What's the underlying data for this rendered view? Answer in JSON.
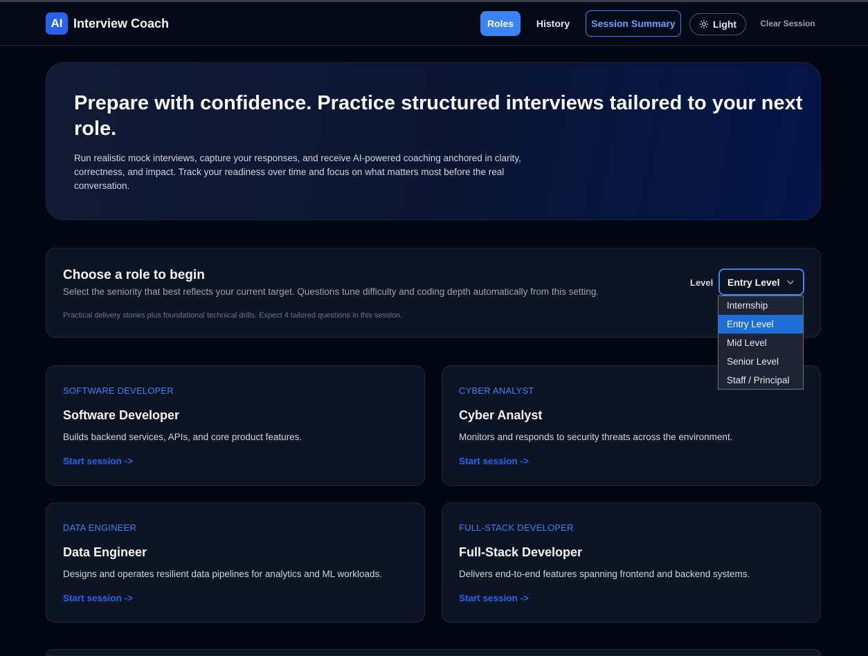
{
  "app": {
    "logo": "AI",
    "title": "Interview Coach"
  },
  "nav": {
    "roles": "Roles",
    "history": "History",
    "session_summary": "Session Summary",
    "theme": "Light",
    "theme_icon": "sun-icon",
    "clear": "Clear Session"
  },
  "hero": {
    "title": "Prepare with confidence. Practice structured interviews tailored to your next role.",
    "text": "Run realistic mock interviews, capture your responses, and receive AI-powered coaching anchored in clarity, correctness, and impact. Track your readiness over time and focus on what matters most before the real conversation."
  },
  "role_panel": {
    "title": "Choose a role to begin",
    "subtitle": "Select the seniority that best reflects your current target. Questions tune difficulty and coding depth automatically from this setting.",
    "note": "Practical delivery stories plus foundational technical drills. Expect 4 tailored questions in this session.",
    "level_label": "Level",
    "level_value": "Entry Level",
    "level_options": [
      "Internship",
      "Entry Level",
      "Mid Level",
      "Senior Level",
      "Staff / Principal"
    ]
  },
  "roles": [
    {
      "tag": "SOFTWARE DEVELOPER",
      "name": "Software Developer",
      "desc": "Builds backend services, APIs, and core product features.",
      "cta": "Start session ->"
    },
    {
      "tag": "CYBER ANALYST",
      "name": "Cyber Analyst",
      "desc": "Monitors and responds to security threats across the environment.",
      "cta": "Start session ->"
    },
    {
      "tag": "DATA ENGINEER",
      "name": "Data Engineer",
      "desc": "Designs and operates resilient data pipelines for analytics and ML workloads.",
      "cta": "Start session ->"
    },
    {
      "tag": "FULL-STACK DEVELOPER",
      "name": "Full-Stack Developer",
      "desc": "Delivers end-to-end features spanning frontend and backend systems.",
      "cta": "Start session ->"
    }
  ],
  "colors": {
    "accent": "#3b82f6",
    "background": "#030712",
    "card": "#0d1424"
  }
}
